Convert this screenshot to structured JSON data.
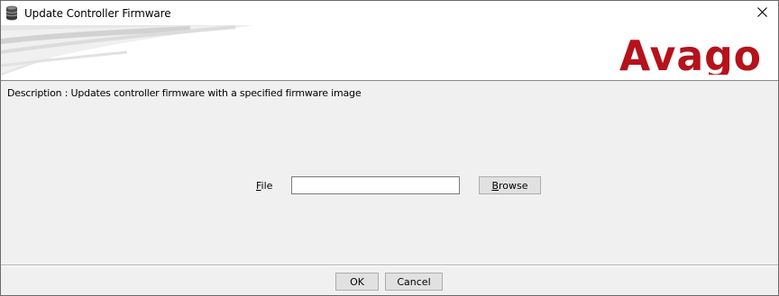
{
  "window": {
    "title": "Update Controller Firmware",
    "close_glyph": "✕"
  },
  "banner": {
    "logo_text": "Avago",
    "logo_color": "#b5121b"
  },
  "content": {
    "description": "Description : Updates controller firmware with a specified firmware image",
    "file_label_mnemonic": "F",
    "file_label_rest": "ile",
    "file_value": "",
    "browse_mnemonic": "B",
    "browse_rest": "rowse"
  },
  "footer": {
    "ok_label": "OK",
    "cancel_label": "Cancel"
  },
  "icons": {
    "app": "database-icon",
    "close": "close-icon"
  }
}
